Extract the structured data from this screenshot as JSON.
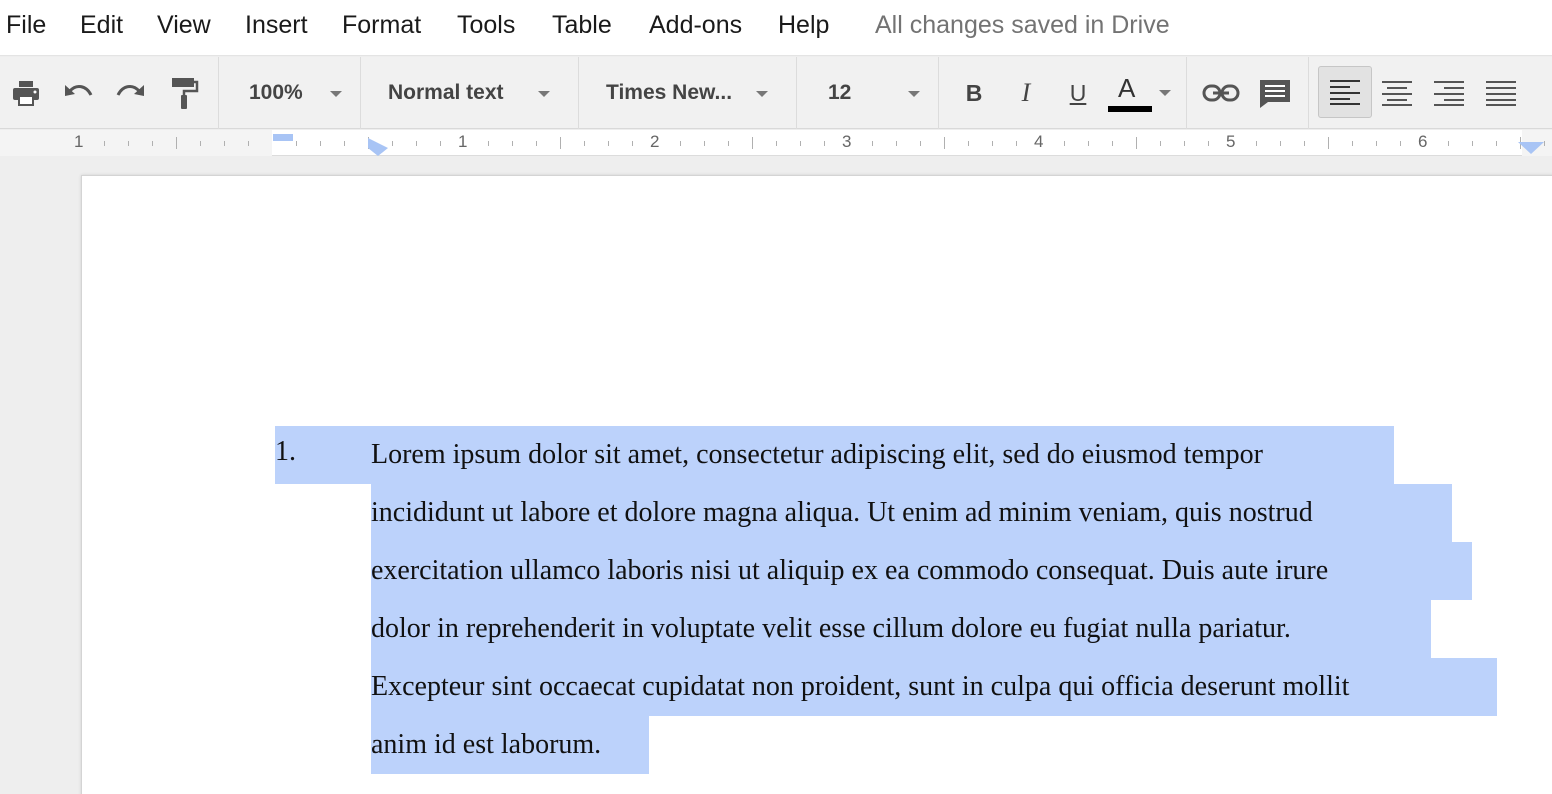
{
  "menu": {
    "items": [
      "File",
      "Edit",
      "View",
      "Insert",
      "Format",
      "Tools",
      "Table",
      "Add-ons",
      "Help"
    ],
    "save_status": "All changes saved in Drive"
  },
  "toolbar": {
    "zoom": "100%",
    "style": "Normal text",
    "font": "Times New...",
    "font_size": "12",
    "bold_label": "B",
    "italic_label": "I",
    "underline_label": "U",
    "text_color_label": "A",
    "text_color": "#000000",
    "active_alignment": "left"
  },
  "ruler": {
    "numbers": [
      "1",
      "1",
      "2",
      "3",
      "4",
      "5",
      "6"
    ]
  },
  "document": {
    "list_number": "1.",
    "lines": [
      "Lorem ipsum dolor sit amet, consectetur adipiscing elit, sed do eiusmod tempor",
      "incididunt ut labore et dolore magna aliqua. Ut enim ad minim veniam, quis nostrud",
      "exercitation ullamco laboris nisi ut aliquip ex ea commodo consequat. Duis aute irure",
      "dolor in reprehenderit in voluptate velit esse cillum dolore eu fugiat nulla pariatur.",
      "Excepteur sint occaecat cupidatat non proident, sunt in culpa qui officia deserunt mollit",
      "anim id est laborum."
    ],
    "selection_color": "#bcd2fb"
  }
}
